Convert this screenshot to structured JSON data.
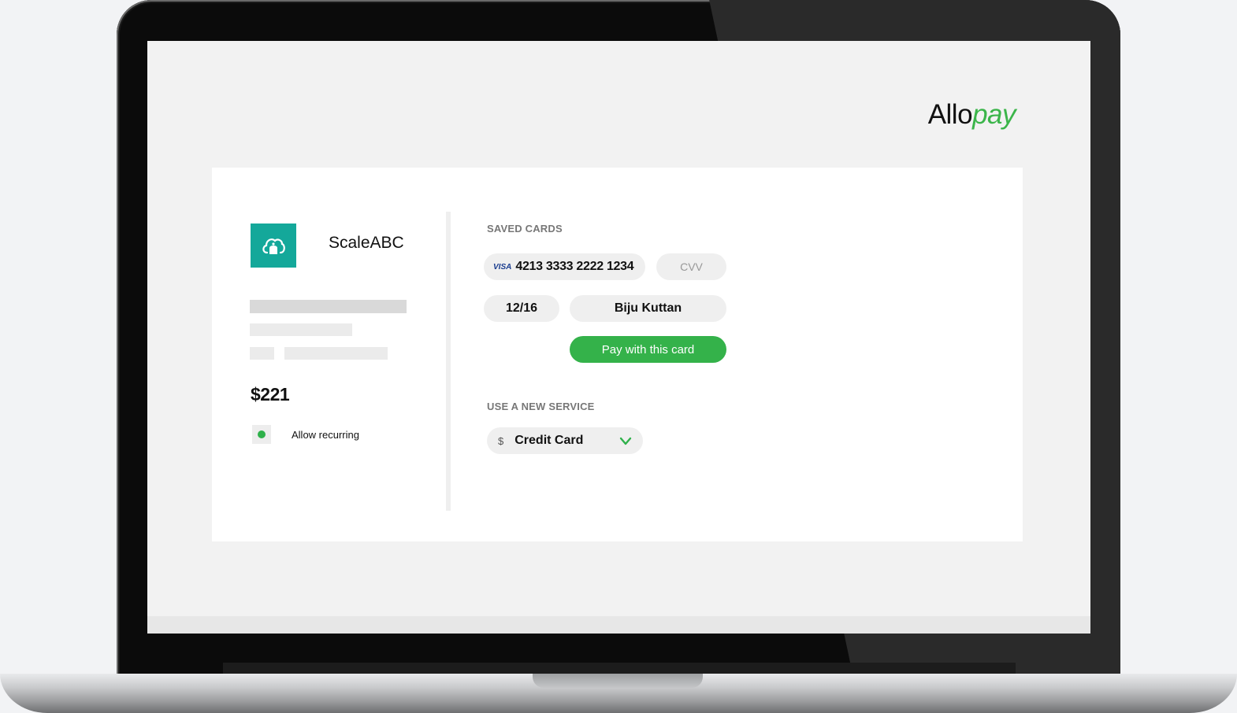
{
  "brand": {
    "name_main": "Allo",
    "name_accent": "pay",
    "accent_color": "#3bb54a"
  },
  "merchant": {
    "name": "ScaleABC",
    "logo_icon": "cloud-bell-icon",
    "logo_color": "#14a89a",
    "amount": "$221",
    "recurring": {
      "label": "Allow recurring",
      "enabled": true
    }
  },
  "saved_cards": {
    "title": "SAVED CARDS",
    "card": {
      "brand_label": "VISA",
      "number": "4213 3333 2222 1234",
      "cvv_placeholder": "CVV",
      "expiry": "12/16",
      "holder": "Biju Kuttan"
    },
    "pay_button_label": "Pay with this card"
  },
  "new_service": {
    "title": "USE A NEW SERVICE",
    "currency_symbol": "$",
    "selected": "Credit Card",
    "dropdown_icon": "chevron-down-icon"
  },
  "colors": {
    "primary_green": "#34b24a",
    "status_dot": "#2fb14b"
  }
}
